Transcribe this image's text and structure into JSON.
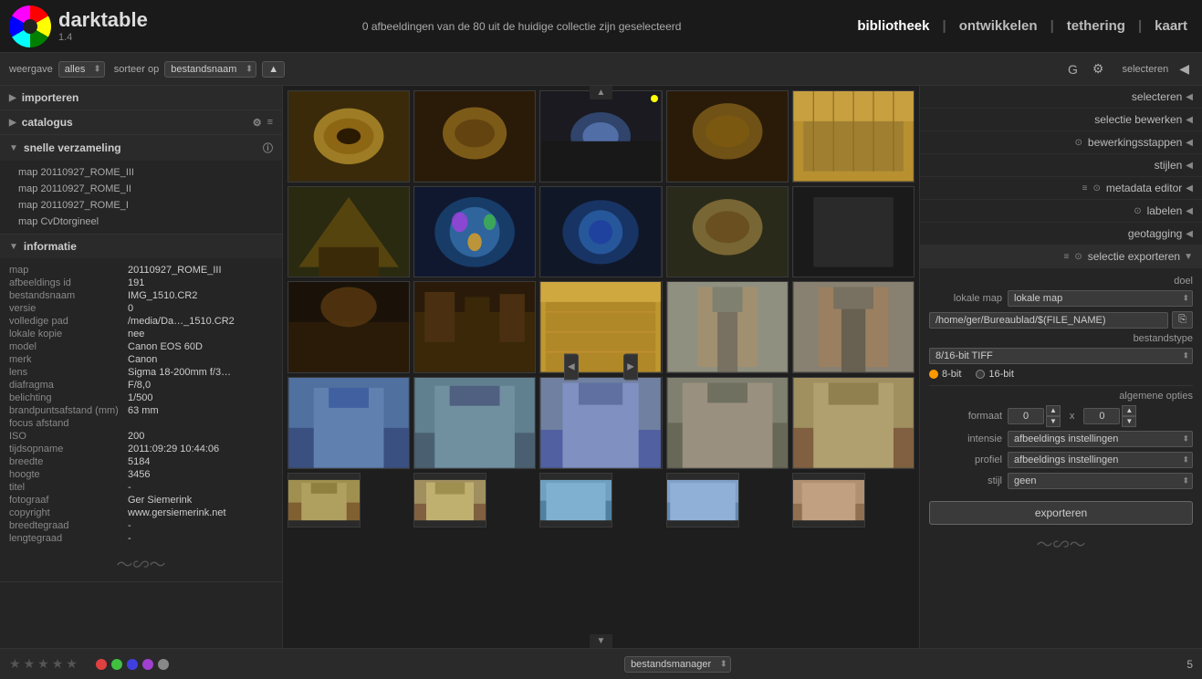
{
  "app": {
    "name": "darktable",
    "version": "1.4",
    "status_message": "0 afbeeldingen van de 80 uit de huidige collectie zijn geselecteerd"
  },
  "top_nav": {
    "bibliotheek": "bibliotheek",
    "ontwikkelen": "ontwikkelen",
    "tethering": "tethering",
    "kaart": "kaart",
    "separator": "|"
  },
  "toolbar": {
    "weergave_label": "weergave",
    "weergave_value": "alles",
    "sorteer_label": "sorteer op",
    "sorteer_value": "bestandsnaam",
    "g_label": "G",
    "selecteren_label": "selecteren"
  },
  "left_sidebar": {
    "sections": [
      {
        "id": "importeren",
        "label": "importeren",
        "collapsed": true
      },
      {
        "id": "catalogus",
        "label": "catalogus",
        "collapsed": true
      },
      {
        "id": "snelle_verzameling",
        "label": "snelle verzameling",
        "collapsed": false,
        "items": [
          "map 20110927_ROME_III",
          "map 20110927_ROME_II",
          "map 20110927_ROME_I",
          "map CvDtorgineel"
        ]
      },
      {
        "id": "informatie",
        "label": "informatie",
        "collapsed": false,
        "fields": [
          {
            "key": "map",
            "value": "20110927_ROME_III"
          },
          {
            "key": "afbeeldings id",
            "value": "191"
          },
          {
            "key": "bestandsnaam",
            "value": "IMG_1510.CR2"
          },
          {
            "key": "versie",
            "value": "0"
          },
          {
            "key": "volledige pad",
            "value": "/media/Da…_1510.CR2"
          },
          {
            "key": "lokale kopie",
            "value": "nee"
          },
          {
            "key": "model",
            "value": "Canon EOS 60D"
          },
          {
            "key": "merk",
            "value": "Canon"
          },
          {
            "key": "lens",
            "value": "Sigma 18-200mm f/3…"
          },
          {
            "key": "diafragma",
            "value": "F/8,0"
          },
          {
            "key": "belichting",
            "value": "1/500"
          },
          {
            "key": "brandpuntsafstand (mm)",
            "value": "63 mm"
          },
          {
            "key": "focus afstand",
            "value": ""
          },
          {
            "key": "ISO",
            "value": "200"
          },
          {
            "key": "tijdsopname",
            "value": "2011:09:29 10:44:06"
          },
          {
            "key": "breedte",
            "value": "5184"
          },
          {
            "key": "hoogte",
            "value": "3456"
          },
          {
            "key": "titel",
            "value": "-"
          },
          {
            "key": "fotograaf",
            "value": "Ger Siemerink"
          },
          {
            "key": "copyright",
            "value": "www.gersiemerink.net"
          },
          {
            "key": "breedtegraad",
            "value": "-"
          },
          {
            "key": "lengtegraad",
            "value": "-"
          }
        ]
      }
    ]
  },
  "right_sidebar": {
    "panel_items": [
      {
        "id": "selecteren",
        "label": "selecteren",
        "arrow": "◀"
      },
      {
        "id": "selectie_bewerken",
        "label": "selectie bewerken",
        "arrow": "◀"
      },
      {
        "id": "bewerkingsstappen",
        "label": "bewerkingsstappen",
        "arrow": "◀",
        "icon": "⊙"
      },
      {
        "id": "stijlen",
        "label": "stijlen",
        "arrow": "◀"
      },
      {
        "id": "metadata_editor",
        "label": "metadata editor",
        "arrow": "◀",
        "icon": "⊙"
      },
      {
        "id": "labelen",
        "label": "labelen",
        "arrow": "◀",
        "icon": "⊙"
      },
      {
        "id": "geotagging",
        "label": "geotagging",
        "arrow": "◀"
      },
      {
        "id": "selectie_exporteren",
        "label": "selectie exporteren",
        "arrow": "▼",
        "icon": "⊙"
      }
    ],
    "export": {
      "doel_label": "doel",
      "lokale_map_label": "lokale map",
      "path_value": "/home/ger/Bureaublad/$(FILE_NAME)",
      "bestandstype_label": "bestandstype",
      "bestandstype_value": "8/16-bit TIFF",
      "bit_8_label": "8-bit",
      "bit_16_label": "16-bit",
      "bit_active": "8-bit",
      "algemene_opties_label": "algemene opties",
      "formaat_label": "formaat",
      "formaat_w": "0",
      "formaat_x": "x",
      "formaat_h": "0",
      "intensie_label": "intensie",
      "intensie_value": "afbeeldings instellingen",
      "profiel_label": "profiel",
      "profiel_value": "afbeeldings instellingen",
      "stijl_label": "stijl",
      "stijl_value": "geen",
      "export_btn": "exporteren"
    }
  },
  "bottom_bar": {
    "stars": [
      "★",
      "★",
      "★",
      "★",
      "★"
    ],
    "color_labels": [
      "red",
      "green",
      "blue",
      "purple",
      "gray"
    ],
    "manager_label": "bestandsmanager",
    "count": "5"
  },
  "thumbnails": {
    "rows": 5,
    "cols": 5,
    "colors": [
      [
        "#8B6914",
        "#7A5C10",
        "#4a3a1a",
        "#6B5010",
        "#c8a840"
      ],
      [
        "#7A6020",
        "#3a6080",
        "#3a6080",
        "#5a5050",
        "#2a2a2a"
      ],
      [
        "#4a3a2a",
        "#5a4a3a",
        "#c8a040",
        "#a09060",
        "#8a8070"
      ],
      [
        "#6070a0",
        "#7090c0",
        "#8090c0",
        "#909080",
        "#b09070"
      ],
      [
        "#a09060",
        "#a09060",
        "#80a0c0",
        "#80a0d0",
        "#c09070"
      ]
    ]
  }
}
